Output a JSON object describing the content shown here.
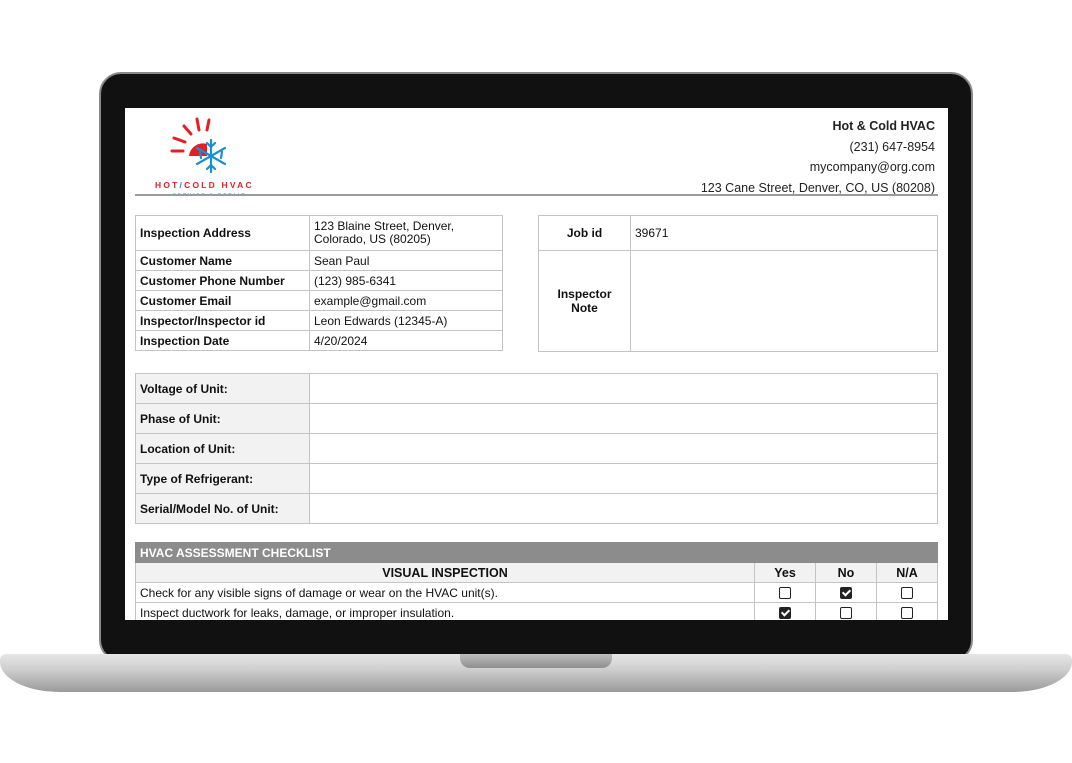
{
  "company": {
    "name": "Hot & Cold HVAC",
    "phone": "(231) 647-8954",
    "email": "mycompany@org.com",
    "address": "123 Cane Street, Denver, CO, US (80208)"
  },
  "logo": {
    "text_hot": "HOT",
    "text_slash": "/",
    "text_cold": "COLD HVAC",
    "subtext": "SERVICE & REPAIR",
    "colors": {
      "sun": "#e31e24",
      "snow": "#1a8fd6"
    }
  },
  "inspection": {
    "address_label": "Inspection Address",
    "address_line1": "123 Blaine Street, Denver,",
    "address_line2": "Colorado, US (80205)",
    "customer_name_label": "Customer Name",
    "customer_name": "Sean Paul",
    "customer_phone_label": "Customer Phone Number",
    "customer_phone": "(123) 985-6341",
    "customer_email_label": "Customer Email",
    "customer_email": "example@gmail.com",
    "inspector_label": "Inspector/Inspector id",
    "inspector": "Leon Edwards (12345-A)",
    "date_label": "Inspection Date",
    "date": "4/20/2024"
  },
  "job": {
    "id_label": "Job id",
    "id": "39671",
    "note_label_line1": "Inspector",
    "note_label_line2": "Note",
    "note": ""
  },
  "unit": {
    "voltage_label": "Voltage of Unit:",
    "phase_label": "Phase of Unit:",
    "location_label": "Location of Unit:",
    "refrigerant_label": "Type of Refrigerant:",
    "serial_label": "Serial/Model No. of Unit:"
  },
  "checklist": {
    "title": "HVAC ASSESSMENT CHECKLIST",
    "section": "VISUAL INSPECTION",
    "col_yes": "Yes",
    "col_no": "No",
    "col_na": "N/A",
    "items": [
      {
        "text": "Check for any visible signs of damage or wear on the HVAC unit(s).",
        "answer": "no"
      },
      {
        "text": "Inspect ductwork for leaks, damage, or improper insulation.",
        "answer": "yes"
      }
    ]
  }
}
